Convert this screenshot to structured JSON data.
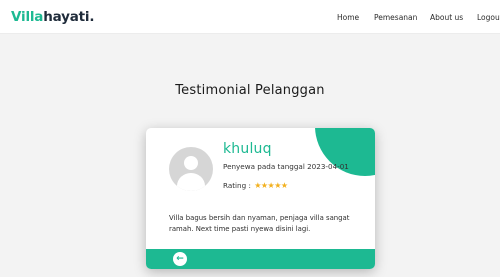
{
  "brand": {
    "part1": "Villa",
    "part2": "hayati",
    "dot": "."
  },
  "nav": {
    "items": [
      {
        "label": "Home"
      },
      {
        "label": "Pemesanan"
      },
      {
        "label": "About us"
      },
      {
        "label": "Logout"
      }
    ]
  },
  "section": {
    "title": "Testimonial Pelanggan"
  },
  "testimonial": {
    "name": "khuluq",
    "date_label": "Penyewa pada tanggal 2023-04-01",
    "rating_label": "Rating :",
    "stars": "★★★★★",
    "rating": 5,
    "text": "Villa bagus bersih dan nyaman, penjaga villa sangat ramah. Next time pasti nyewa disini lagi.",
    "prev_icon": "←"
  },
  "colors": {
    "accent": "#1db992",
    "star": "#f2b01e",
    "dark": "#1f2b3a"
  }
}
